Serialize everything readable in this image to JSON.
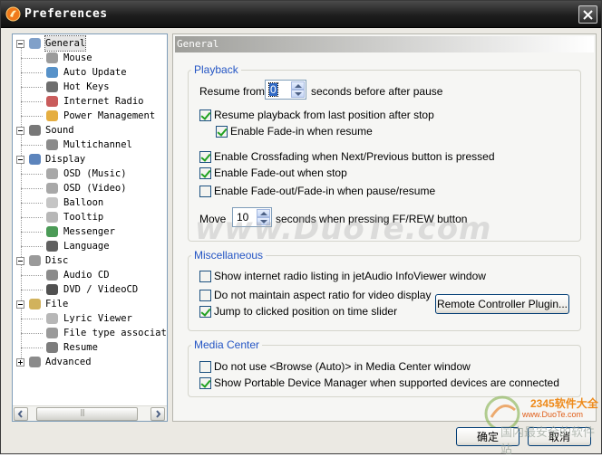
{
  "window": {
    "title": "Preferences"
  },
  "tree": {
    "items": [
      {
        "label": "General",
        "level": 0,
        "expander": "minus",
        "icon": "checklist-icon",
        "selected": true
      },
      {
        "label": "Mouse",
        "level": 1,
        "icon": "mouse-icon"
      },
      {
        "label": "Auto Update",
        "level": 1,
        "icon": "globe-icon"
      },
      {
        "label": "Hot Keys",
        "level": 1,
        "icon": "keyboard-icon"
      },
      {
        "label": "Internet Radio",
        "level": 1,
        "icon": "radio-icon"
      },
      {
        "label": "Power Management",
        "level": 1,
        "icon": "power-icon"
      },
      {
        "label": "Sound",
        "level": 0,
        "expander": "minus",
        "icon": "speaker-icon"
      },
      {
        "label": "Multichannel",
        "level": 1,
        "icon": "headphones-icon"
      },
      {
        "label": "Display",
        "level": 0,
        "expander": "minus",
        "icon": "monitor-icon"
      },
      {
        "label": "OSD (Music)",
        "level": 1,
        "icon": "osd-music-icon"
      },
      {
        "label": "OSD (Video)",
        "level": 1,
        "icon": "osd-video-icon"
      },
      {
        "label": "Balloon",
        "level": 1,
        "icon": "balloon-icon"
      },
      {
        "label": "Tooltip",
        "level": 1,
        "icon": "tooltip-icon"
      },
      {
        "label": "Messenger",
        "level": 1,
        "icon": "messenger-icon"
      },
      {
        "label": "Language",
        "level": 1,
        "icon": "language-icon"
      },
      {
        "label": "Disc",
        "level": 0,
        "expander": "minus",
        "icon": "disc-icon"
      },
      {
        "label": "Audio CD",
        "level": 1,
        "icon": "audio-cd-icon"
      },
      {
        "label": "DVD / VideoCD",
        "level": 1,
        "icon": "dvd-icon"
      },
      {
        "label": "File",
        "level": 0,
        "expander": "minus",
        "icon": "folder-icon"
      },
      {
        "label": "Lyric Viewer",
        "level": 1,
        "icon": "lyric-icon"
      },
      {
        "label": "File type associat",
        "level": 1,
        "icon": "file-type-icon"
      },
      {
        "label": "Resume",
        "level": 1,
        "icon": "resume-icon"
      },
      {
        "label": "Advanced",
        "level": 0,
        "expander": "plus",
        "icon": "advanced-icon"
      }
    ]
  },
  "panel": {
    "title": "General"
  },
  "playback": {
    "title": "Playback",
    "resume_from_label": "Resume from",
    "resume_from_value": "0",
    "resume_from_suffix": "seconds before after pause",
    "resume_last_position": {
      "label": "Resume playback from last position after stop",
      "checked": true
    },
    "fade_in_on_resume": {
      "label": "Enable Fade-in when resume",
      "checked": true
    },
    "crossfading": {
      "label": "Enable Crossfading when Next/Previous button is pressed",
      "checked": true
    },
    "fade_out_on_stop": {
      "label": "Enable Fade-out when stop",
      "checked": true
    },
    "fade_on_pause": {
      "label": "Enable Fade-out/Fade-in when pause/resume",
      "checked": false
    },
    "move_label": "Move",
    "move_value": "10",
    "move_suffix": "seconds when pressing FF/REW button"
  },
  "misc": {
    "title": "Miscellaneous",
    "show_radio_listing": {
      "label": "Show internet radio listing in jetAudio InfoViewer window",
      "checked": false
    },
    "no_aspect_ratio": {
      "label": "Do not maintain aspect ratio for video display",
      "checked": false
    },
    "jump_to_clicked": {
      "label": "Jump to clicked position on time slider",
      "checked": true
    },
    "remote_plugin_button": "Remote Controller Plugin..."
  },
  "media_center": {
    "title": "Media Center",
    "no_browse_auto": {
      "label": "Do not use <Browse (Auto)> in Media Center window",
      "checked": false
    },
    "show_portable_manager": {
      "label": "Show Portable Device Manager when supported devices are connected",
      "checked": true
    }
  },
  "buttons": {
    "ok": "确定",
    "cancel": "取消"
  },
  "watermarks": {
    "center": "www.DuoTe.com",
    "brand": "2345软件大全",
    "url": "www.DuoTe.com",
    "cn": "国内最安全的软件站"
  },
  "colors": {
    "group_title": "#2455c4",
    "checkmark": "#21a121",
    "title_bar": "#1e1e1e"
  }
}
